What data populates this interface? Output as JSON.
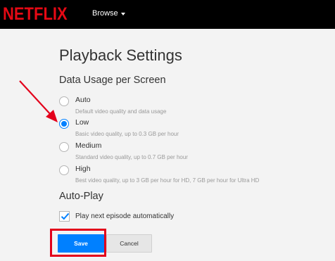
{
  "header": {
    "logo": "NETFLIX",
    "browse_label": "Browse"
  },
  "page": {
    "title": "Playback Settings",
    "data_usage_title": "Data Usage per Screen",
    "options": [
      {
        "label": "Auto",
        "desc": "Default video quality and data usage",
        "selected": false
      },
      {
        "label": "Low",
        "desc": "Basic video quality, up to 0.3 GB per hour",
        "selected": true
      },
      {
        "label": "Medium",
        "desc": "Standard video quality, up to 0.7 GB per hour",
        "selected": false
      },
      {
        "label": "High",
        "desc": "Best video quality, up to 3 GB per hour for HD, 7 GB per hour for Ultra HD",
        "selected": false
      }
    ],
    "autoplay_title": "Auto-Play",
    "autoplay_label": "Play next episode automatically",
    "autoplay_checked": true
  },
  "buttons": {
    "save": "Save",
    "cancel": "Cancel"
  },
  "colors": {
    "brand": "#e50914",
    "accent": "#0080ff",
    "annotation": "#e3001b"
  },
  "icons": {
    "browse_caret": "chevron-down-icon",
    "checkbox_mark": "checkmark-icon",
    "annotation_arrow": "arrow-icon"
  }
}
